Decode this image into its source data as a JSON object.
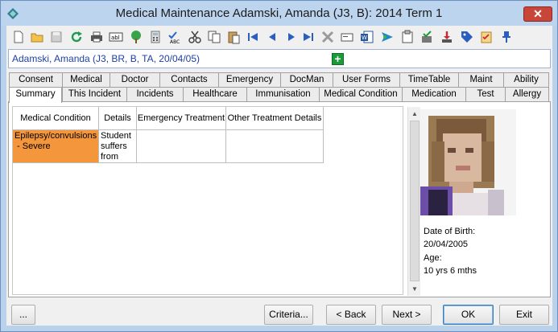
{
  "window": {
    "title": "Medical Maintenance   Adamski, Amanda (J3, B): 2014 Term 1",
    "close_label": "✕"
  },
  "toolbar": {
    "icons": [
      "new-icon",
      "open-icon",
      "save-icon",
      "refresh-icon",
      "print-icon",
      "text-field-icon",
      "tree-icon",
      "calculator-icon",
      "spellcheck-icon",
      "cut-icon",
      "copy-icon",
      "paste-icon",
      "first-record-icon",
      "previous-record-icon",
      "next-record-icon",
      "last-record-icon",
      "delete-icon",
      "card-icon",
      "word-icon",
      "send-icon",
      "clipboard-icon",
      "approve-icon",
      "download-icon",
      "tag-icon",
      "checklist-icon",
      "pin-icon"
    ]
  },
  "student": {
    "name_line": "Adamski, Amanda (J3, BR, B, TA, 20/04/05)",
    "add_label": "+"
  },
  "tabs_top": [
    "Consent",
    "Medical",
    "Doctor",
    "Contacts",
    "Emergency",
    "DocMan",
    "User Forms",
    "TimeTable",
    "Maint",
    "Ability"
  ],
  "tabs_bottom": [
    "Summary",
    "This Incident",
    "Incidents",
    "Healthcare",
    "Immunisation",
    "Medical Condition",
    "Medication",
    "Test",
    "Allergy"
  ],
  "active_tab": "Summary",
  "grid": {
    "columns": [
      "Medical Condition",
      "Details",
      "Emergency Treatment",
      "Other Treatment Details"
    ],
    "rows": [
      {
        "condition": "Epilepsy/convulsions\n - Severe",
        "details": "Student\nsuffers\nfrom",
        "emergency": "",
        "other": ""
      }
    ]
  },
  "profile": {
    "dob_label": "Date of Birth:",
    "dob_value": "20/04/2005",
    "age_label": "Age:",
    "age_value": "10 yrs 6 mths"
  },
  "buttons": {
    "more": "...",
    "criteria": "Criteria...",
    "back": "< Back",
    "next": "Next >",
    "ok": "OK",
    "exit": "Exit"
  },
  "colors": {
    "highlight": "#f4963c",
    "name_text": "#1d3fa8",
    "add_green": "#1a9b3a"
  }
}
